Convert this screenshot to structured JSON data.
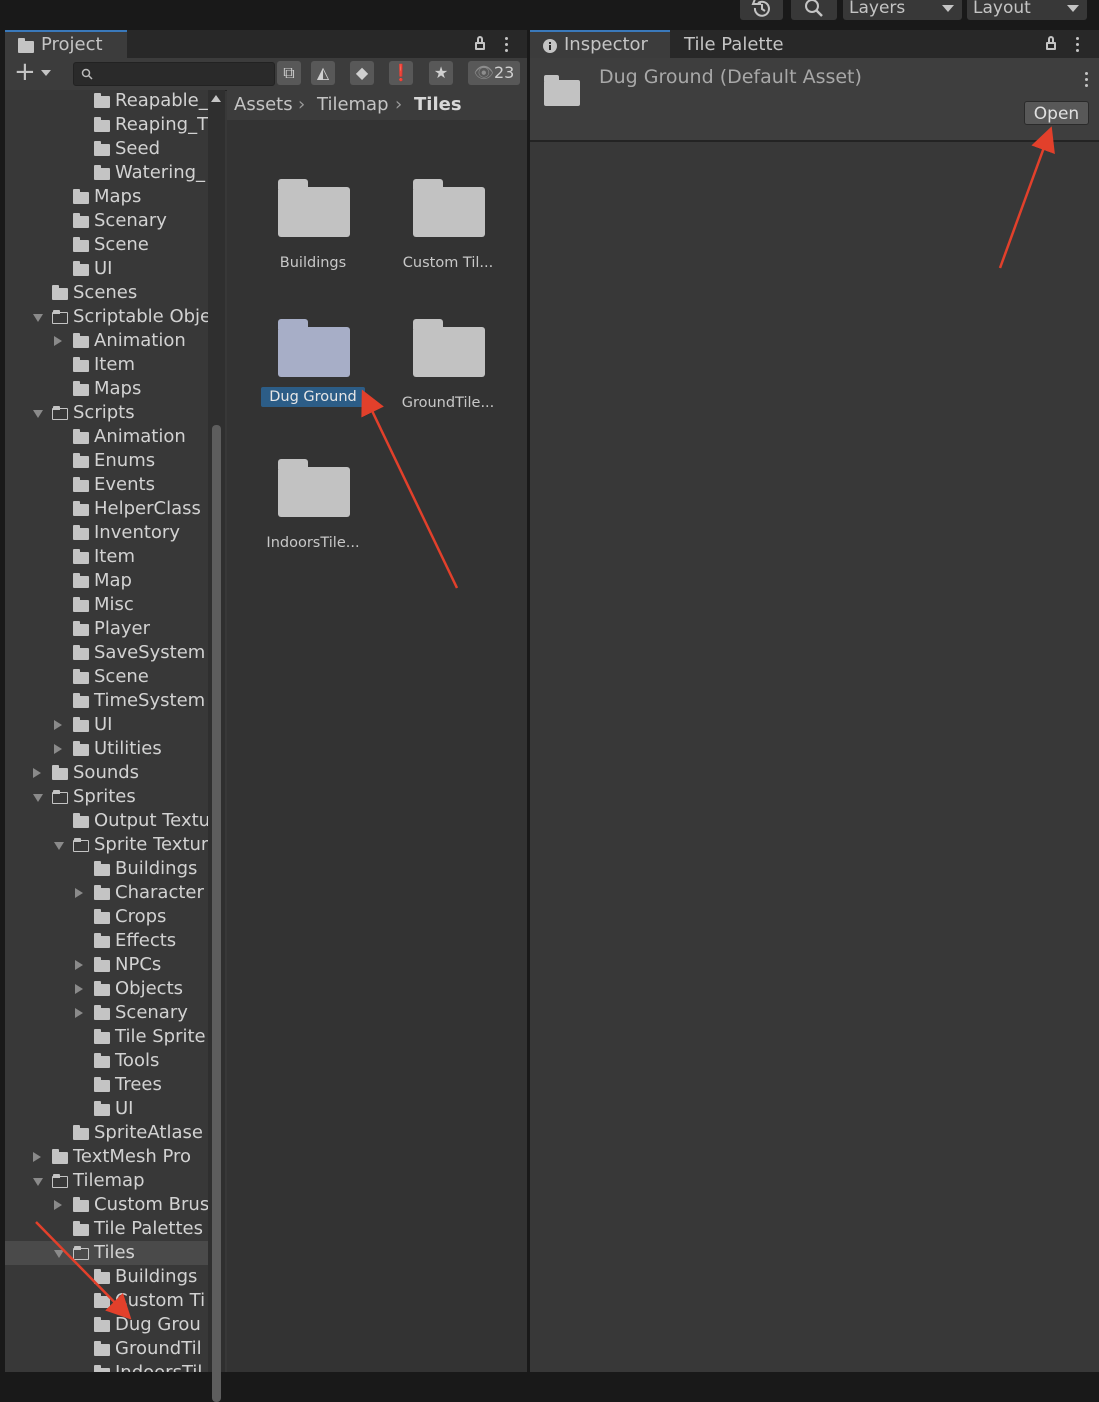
{
  "toolbar": {
    "history_icon": "history-icon",
    "search_icon": "search-icon",
    "layers_label": "Layers",
    "layout_label": "Layout"
  },
  "project": {
    "tab_label": "Project",
    "hidden_count": "23",
    "search": {
      "value": "",
      "placeholder": ""
    },
    "tree": [
      {
        "label": "Reapable_",
        "depth": 3
      },
      {
        "label": "Reaping_T",
        "depth": 3
      },
      {
        "label": "Seed",
        "depth": 3
      },
      {
        "label": "Watering_",
        "depth": 3
      },
      {
        "label": "Maps",
        "depth": 2
      },
      {
        "label": "Scenary",
        "depth": 2
      },
      {
        "label": "Scene",
        "depth": 2
      },
      {
        "label": "UI",
        "depth": 2
      },
      {
        "label": "Scenes",
        "depth": 1
      },
      {
        "label": "Scriptable Obje",
        "depth": 1,
        "expander": "open"
      },
      {
        "label": "Animation",
        "depth": 2,
        "expander": "closed"
      },
      {
        "label": "Item",
        "depth": 2
      },
      {
        "label": "Maps",
        "depth": 2
      },
      {
        "label": "Scripts",
        "depth": 1,
        "expander": "open"
      },
      {
        "label": "Animation",
        "depth": 2
      },
      {
        "label": "Enums",
        "depth": 2
      },
      {
        "label": "Events",
        "depth": 2
      },
      {
        "label": "HelperClass",
        "depth": 2
      },
      {
        "label": "Inventory",
        "depth": 2
      },
      {
        "label": "Item",
        "depth": 2
      },
      {
        "label": "Map",
        "depth": 2
      },
      {
        "label": "Misc",
        "depth": 2
      },
      {
        "label": "Player",
        "depth": 2
      },
      {
        "label": "SaveSystem",
        "depth": 2
      },
      {
        "label": "Scene",
        "depth": 2
      },
      {
        "label": "TimeSystem",
        "depth": 2
      },
      {
        "label": "UI",
        "depth": 2,
        "expander": "closed"
      },
      {
        "label": "Utilities",
        "depth": 2,
        "expander": "closed"
      },
      {
        "label": "Sounds",
        "depth": 1,
        "expander": "closed"
      },
      {
        "label": "Sprites",
        "depth": 1,
        "expander": "open"
      },
      {
        "label": "Output Textu",
        "depth": 2
      },
      {
        "label": "Sprite Textur",
        "depth": 2,
        "expander": "open"
      },
      {
        "label": "Buildings",
        "depth": 3
      },
      {
        "label": "Character",
        "depth": 3,
        "expander": "closed"
      },
      {
        "label": "Crops",
        "depth": 3
      },
      {
        "label": "Effects",
        "depth": 3
      },
      {
        "label": "NPCs",
        "depth": 3,
        "expander": "closed"
      },
      {
        "label": "Objects",
        "depth": 3,
        "expander": "closed"
      },
      {
        "label": "Scenary",
        "depth": 3,
        "expander": "closed"
      },
      {
        "label": "Tile Sprite",
        "depth": 3
      },
      {
        "label": "Tools",
        "depth": 3
      },
      {
        "label": "Trees",
        "depth": 3
      },
      {
        "label": "UI",
        "depth": 3
      },
      {
        "label": "SpriteAtlase",
        "depth": 2
      },
      {
        "label": "TextMesh Pro",
        "depth": 1,
        "expander": "closed"
      },
      {
        "label": "Tilemap",
        "depth": 1,
        "expander": "open"
      },
      {
        "label": "Custom Brus",
        "depth": 2,
        "expander": "closed"
      },
      {
        "label": "Tile Palettes",
        "depth": 2
      },
      {
        "label": "Tiles",
        "depth": 2,
        "expander": "open",
        "selected": true
      },
      {
        "label": "Buildings",
        "depth": 3
      },
      {
        "label": "Custom Ti",
        "depth": 3
      },
      {
        "label": "Dug Grou",
        "depth": 3
      },
      {
        "label": "GroundTil",
        "depth": 3
      },
      {
        "label": "IndoorsTil",
        "depth": 3
      }
    ],
    "breadcrumb": [
      "Assets",
      "Tilemap",
      "Tiles"
    ],
    "assets": [
      {
        "label": "Buildings"
      },
      {
        "label": "Custom Til..."
      },
      {
        "label": "Dug Ground",
        "selected": true
      },
      {
        "label": "GroundTile..."
      },
      {
        "label": "IndoorsTile..."
      }
    ]
  },
  "inspector": {
    "tab_label": "Inspector",
    "tab2_label": "Tile Palette",
    "asset_title": "Dug Ground (Default Asset)",
    "open_button": "Open"
  },
  "annotation_color": "#e2402b"
}
